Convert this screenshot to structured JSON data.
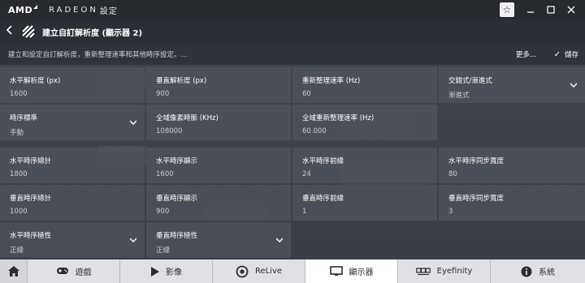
{
  "titlebar": {
    "brand": "AMD",
    "product": "RADEON",
    "settings": "設定"
  },
  "header": {
    "title": "建立自訂解析度 (顯示器 2)",
    "description": "建立和設定自訂解析度，重新整理速率和其他時序設定。...",
    "more_label": "更多...",
    "save_label": "儲存"
  },
  "fields": {
    "h_res": {
      "label": "水平解析度 (px)",
      "value": "1600"
    },
    "v_res": {
      "label": "垂直解析度 (px)",
      "value": "900"
    },
    "refresh": {
      "label": "重新整理速率 (Hz)",
      "value": "60"
    },
    "scan": {
      "label": "交錯式/漸進式",
      "value": "漸進式"
    },
    "timing_std": {
      "label": "時序標準",
      "value": "手動"
    },
    "pixel_clock": {
      "label": "全域像素時脈 (KHz)",
      "value": "108000"
    },
    "global_refresh": {
      "label": "全域重新整理速率 (Hz)",
      "value": "60.000"
    },
    "h_total": {
      "label": "水平時序總計",
      "value": "1800"
    },
    "h_display": {
      "label": "水平時序顯示",
      "value": "1600"
    },
    "h_front": {
      "label": "水平時序前緣",
      "value": "24"
    },
    "h_sync": {
      "label": "水平時序同步寬度",
      "value": "80"
    },
    "v_total": {
      "label": "垂直時序總計",
      "value": "1000"
    },
    "v_display": {
      "label": "垂直時序顯示",
      "value": "900"
    },
    "v_front": {
      "label": "垂直時序前緣",
      "value": "1"
    },
    "v_sync": {
      "label": "垂直時序同步寬度",
      "value": "3"
    },
    "h_polarity": {
      "label": "水平時序極性",
      "value": "正緣"
    },
    "v_polarity": {
      "label": "垂直時序極性",
      "value": "正緣"
    }
  },
  "nav": {
    "items": [
      {
        "label": "遊戲",
        "icon": "gamepad-icon"
      },
      {
        "label": "影像",
        "icon": "play-icon"
      },
      {
        "label": "ReLive",
        "icon": "relive-icon"
      },
      {
        "label": "顯示器",
        "icon": "monitor-icon"
      },
      {
        "label": "Eyefinity",
        "icon": "eyefinity-icon"
      },
      {
        "label": "系統",
        "icon": "info-icon"
      }
    ],
    "active": "ReLive"
  },
  "colors": {
    "accent": "#ffffff",
    "panel": "#4e535c",
    "nav_bg": "#dfe1e4"
  }
}
